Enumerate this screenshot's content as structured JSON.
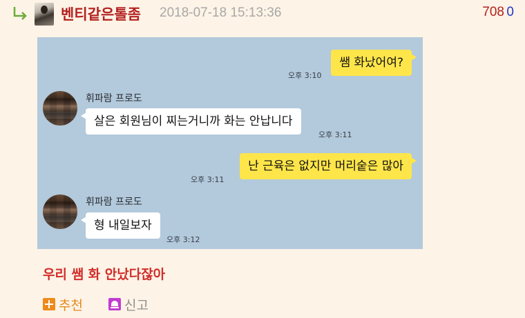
{
  "post": {
    "username": "벤티같은톨좀",
    "timestamp": "2018-07-18 15:13:36",
    "upvotes": "708",
    "downvotes": "0"
  },
  "chat": {
    "messages": [
      {
        "side": "mine",
        "text": "쌤 화났어여?",
        "time": "오후 3:10"
      },
      {
        "side": "theirs",
        "sender": "휘파람 프로도",
        "text": "살은 회원님이 찌는거니까 화는 안납니다",
        "time": "오후 3:11"
      },
      {
        "side": "mine",
        "text": "난 근육은 없지만 머리숱은 많아",
        "time": "오후 3:11"
      },
      {
        "side": "theirs",
        "sender": "휘파람 프로도",
        "text": "형 내일보자",
        "time": "오후 3:12"
      }
    ]
  },
  "caption": "우리 쌤 화 안났다잖아",
  "actions": {
    "recommend_label": "추천",
    "report_label": "신고"
  },
  "colors": {
    "page_bg": "#fdf3e6",
    "chat_bg": "#b3c9dc",
    "my_bubble": "#fee64a",
    "their_bubble": "#ffffff",
    "username": "#b3211f",
    "caption": "#d02d2a",
    "upvote": "#b3211f",
    "downvote": "#2337c8"
  }
}
